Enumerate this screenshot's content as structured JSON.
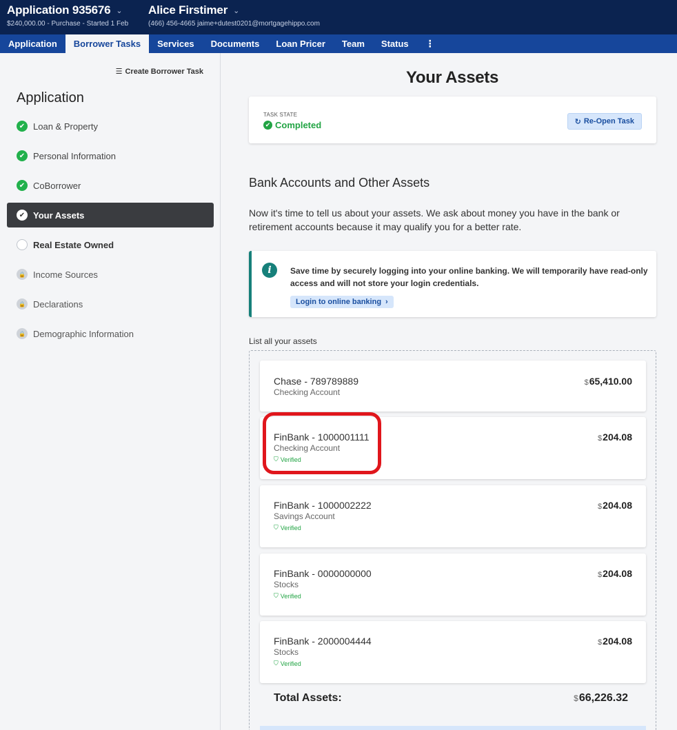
{
  "header": {
    "application_title": "Application 935676",
    "application_sub": "$240,000.00 - Purchase - Started 1 Feb",
    "borrower_name": "Alice Firstimer",
    "borrower_sub": "(466) 456-4665   jaime+dutest0201@mortgagehippo.com"
  },
  "tabs": [
    {
      "label": "Application"
    },
    {
      "label": "Borrower Tasks"
    },
    {
      "label": "Services"
    },
    {
      "label": "Documents"
    },
    {
      "label": "Loan Pricer"
    },
    {
      "label": "Team"
    },
    {
      "label": "Status"
    },
    {
      "label": "⋮"
    }
  ],
  "sidebar": {
    "create_task_label": "Create Borrower Task",
    "heading": "Application",
    "items": [
      {
        "label": "Loan & Property",
        "status": "complete"
      },
      {
        "label": "Personal Information",
        "status": "complete"
      },
      {
        "label": "CoBorrower",
        "status": "complete"
      },
      {
        "label": "Your Assets",
        "status": "active"
      },
      {
        "label": "Real Estate Owned",
        "status": "open"
      },
      {
        "label": "Income Sources",
        "status": "locked"
      },
      {
        "label": "Declarations",
        "status": "locked"
      },
      {
        "label": "Demographic Information",
        "status": "locked"
      }
    ]
  },
  "main": {
    "title": "Your Assets",
    "task_state_label": "TASK STATE",
    "task_state_value": "Completed",
    "reopen_label": "Re-Open Task",
    "section_title": "Bank Accounts and Other Assets",
    "section_desc": "Now it's time to tell us about your assets. We ask about money you have in the bank or retirement accounts because it may qualify you for a better rate.",
    "info_text": "Save time by securely logging into your online banking. We will temporarily have read-only access and will not store your login credentials.",
    "info_button": "Login to online banking",
    "list_label": "List all your assets",
    "currency": "$",
    "assets": [
      {
        "name": "Chase - 789789889",
        "type": "Checking Account",
        "amount": "65,410.00",
        "verified": ""
      },
      {
        "name": "FinBank - 1000001111",
        "type": "Checking Account",
        "amount": "204.08",
        "verified": "Verified"
      },
      {
        "name": "FinBank - 1000002222",
        "type": "Savings Account",
        "amount": "204.08",
        "verified": "Verified"
      },
      {
        "name": "FinBank - 0000000000",
        "type": "Stocks",
        "amount": "204.08",
        "verified": "Verified"
      },
      {
        "name": "FinBank - 2000004444",
        "type": "Stocks",
        "amount": "204.08",
        "verified": "Verified"
      }
    ],
    "total_label": "Total Assets:",
    "total_amount": "66,226.32"
  },
  "colors": {
    "header_bg": "#0b2350",
    "tab_bar_bg": "#16469b",
    "success": "#22a444",
    "info_accent": "#16807a",
    "highlight": "#e0161c"
  }
}
